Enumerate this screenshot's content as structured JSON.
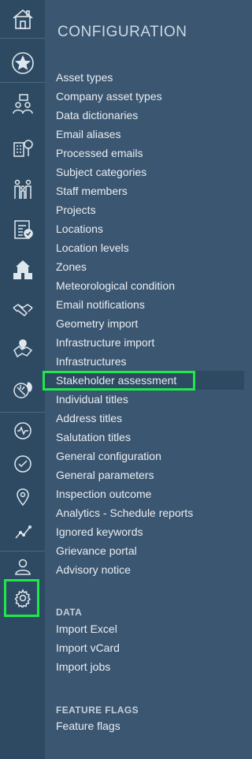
{
  "sidebar": {
    "icons": [
      "home-icon",
      "star-icon",
      "people-icon",
      "building-tree-icon",
      "family-icon",
      "checklist-icon",
      "houses-icon",
      "handshake-icon",
      "map-pin-region-icon",
      "leaf-icon",
      "activity-icon",
      "check-circle-icon",
      "location-icon",
      "trend-icon",
      "user-icon",
      "settings-icon"
    ]
  },
  "panel": {
    "title": "CONFIGURATION",
    "config_items": [
      "Asset types",
      "Company asset types",
      "Data dictionaries",
      "Email aliases",
      "Processed emails",
      "Subject categories",
      "Staff members",
      "Projects",
      "Locations",
      "Location levels",
      "Zones",
      "Meteorological condition",
      "Email notifications",
      "Geometry import",
      "Infrastructure import",
      "Infrastructures",
      "Stakeholder assessment",
      "Individual titles",
      "Address titles",
      "Salutation titles",
      "General configuration",
      "General parameters",
      "Inspection outcome",
      "Analytics - Schedule reports",
      "Ignored keywords",
      "Grievance portal",
      "Advisory notice"
    ],
    "data_section": {
      "title": "DATA",
      "items": [
        "Import Excel",
        "Import vCard",
        "Import jobs"
      ]
    },
    "flags_section": {
      "title": "FEATURE FLAGS",
      "items": [
        "Feature flags"
      ]
    }
  },
  "colors": {
    "rail_bg": "#2e4a62",
    "panel_bg": "#3b5670",
    "highlight_border": "#1ee84a"
  }
}
